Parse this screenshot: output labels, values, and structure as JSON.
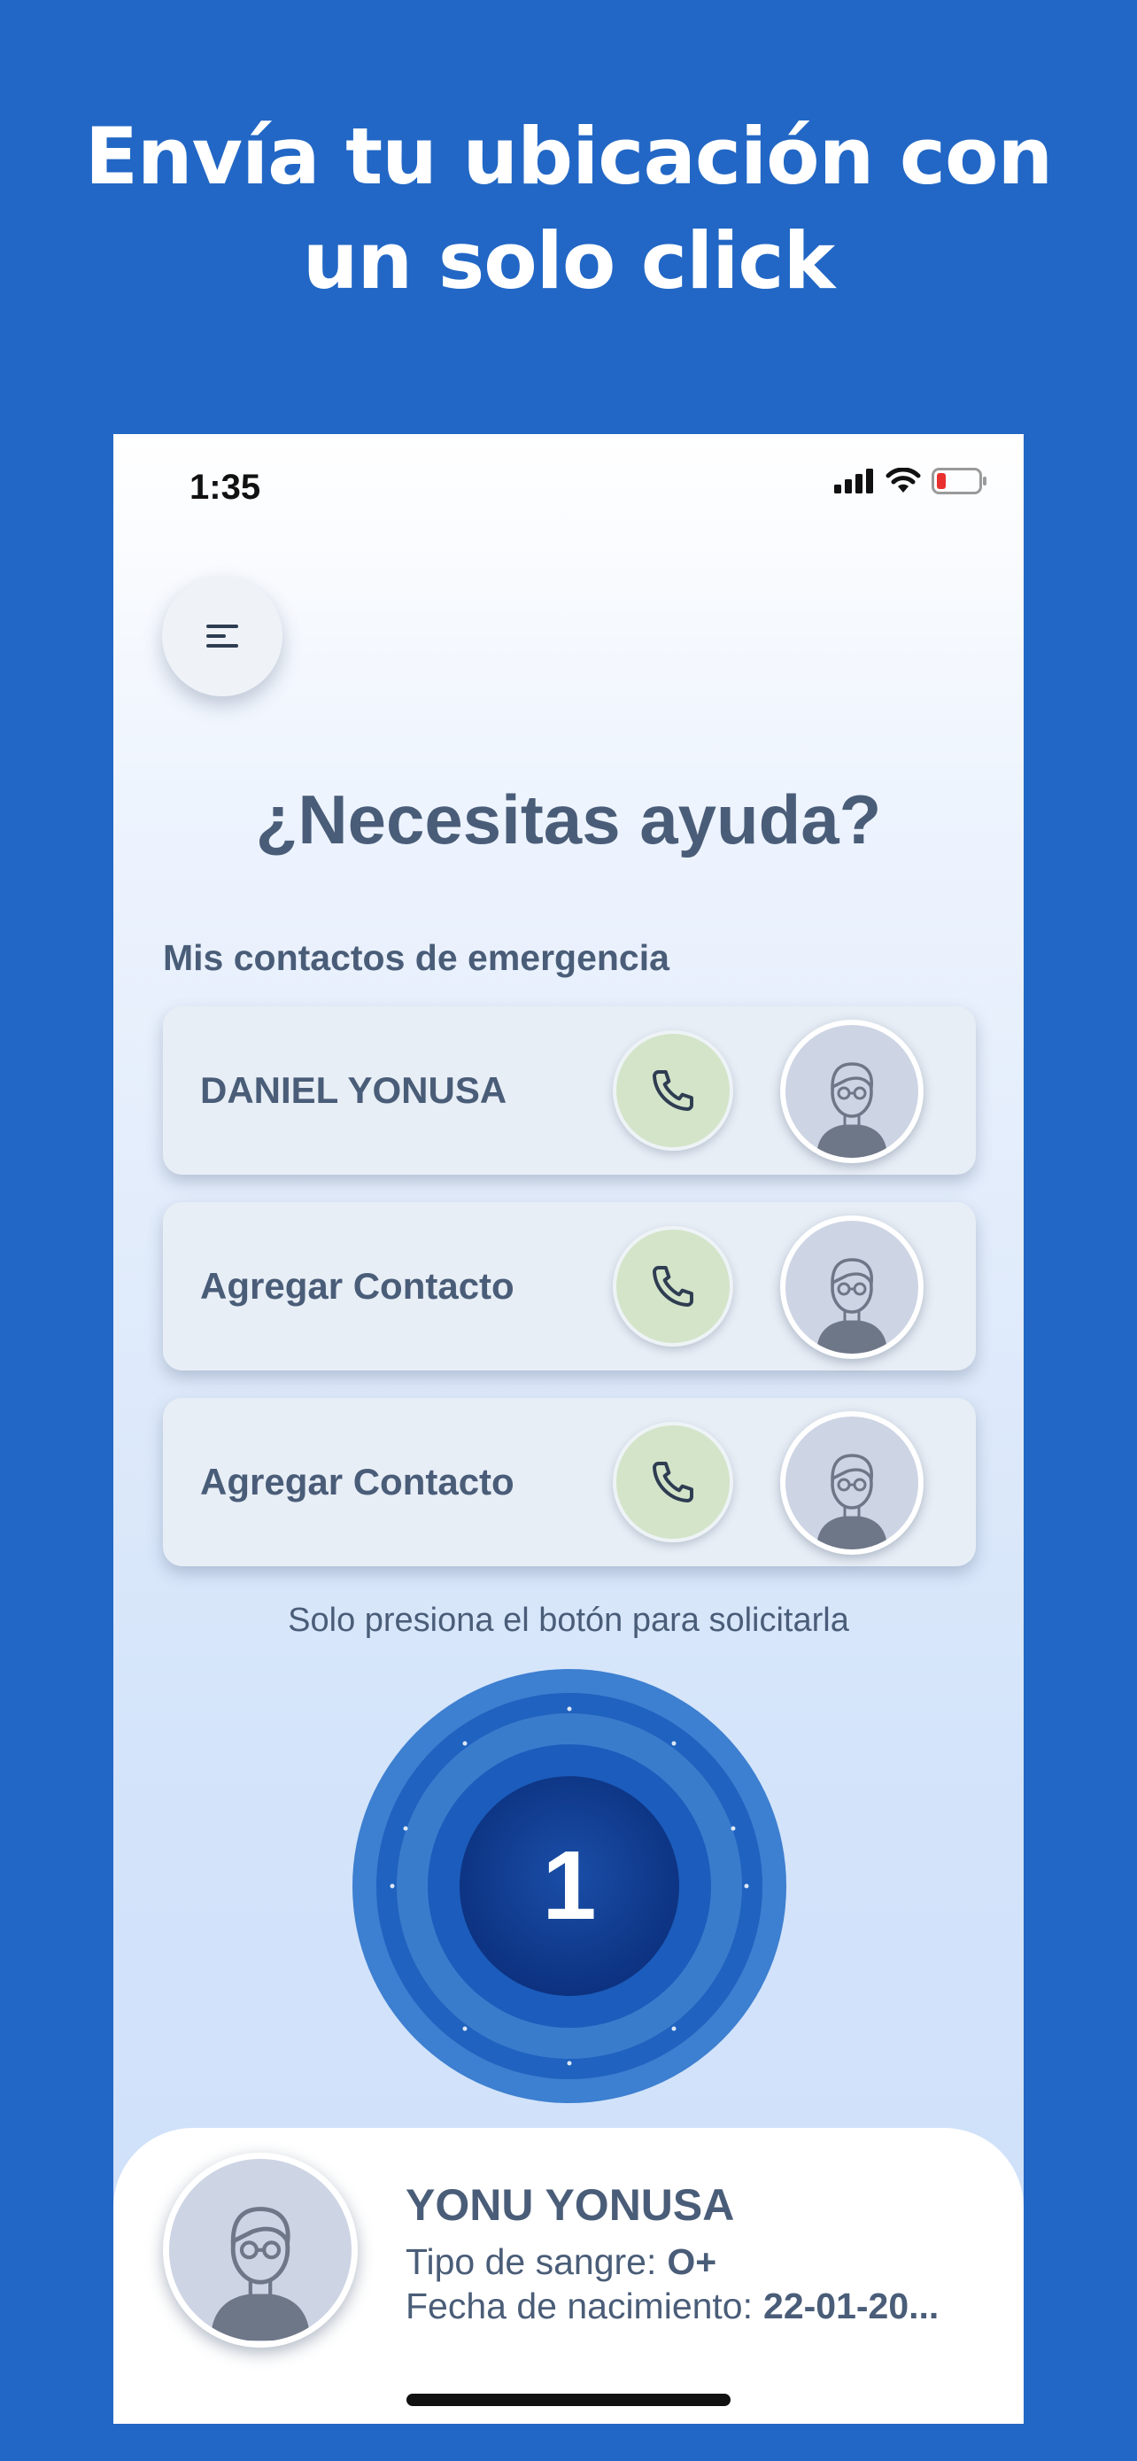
{
  "headline": {
    "line1": "Envía tu ubicación con",
    "line2": "un solo click"
  },
  "status_bar": {
    "time": "1:35",
    "icons": [
      "signal-icon",
      "wifi-icon",
      "battery-low-icon"
    ]
  },
  "menu": {
    "icon": "menu-icon"
  },
  "title": "¿Necesitas ayuda?",
  "contacts_label": "Mis contactos de emergencia",
  "contacts": [
    {
      "name": "DANIEL YONUSA"
    },
    {
      "name": "Agregar Contacto"
    },
    {
      "name": "Agregar Contacto"
    }
  ],
  "hint": "Solo presiona el botón para solicitarla",
  "sos_button": {
    "value": "1"
  },
  "profile": {
    "name": "YONU YONUSA",
    "blood_label": "Tipo de sangre:",
    "blood_value": "O+",
    "birth_label": "Fecha de nacimiento:",
    "birth_value": "22-01-20..."
  },
  "colors": {
    "background": "#2267c5",
    "text": "#4a5d78",
    "call_button": "#d3e4c9",
    "sos_inner": "#0d3a8c"
  }
}
